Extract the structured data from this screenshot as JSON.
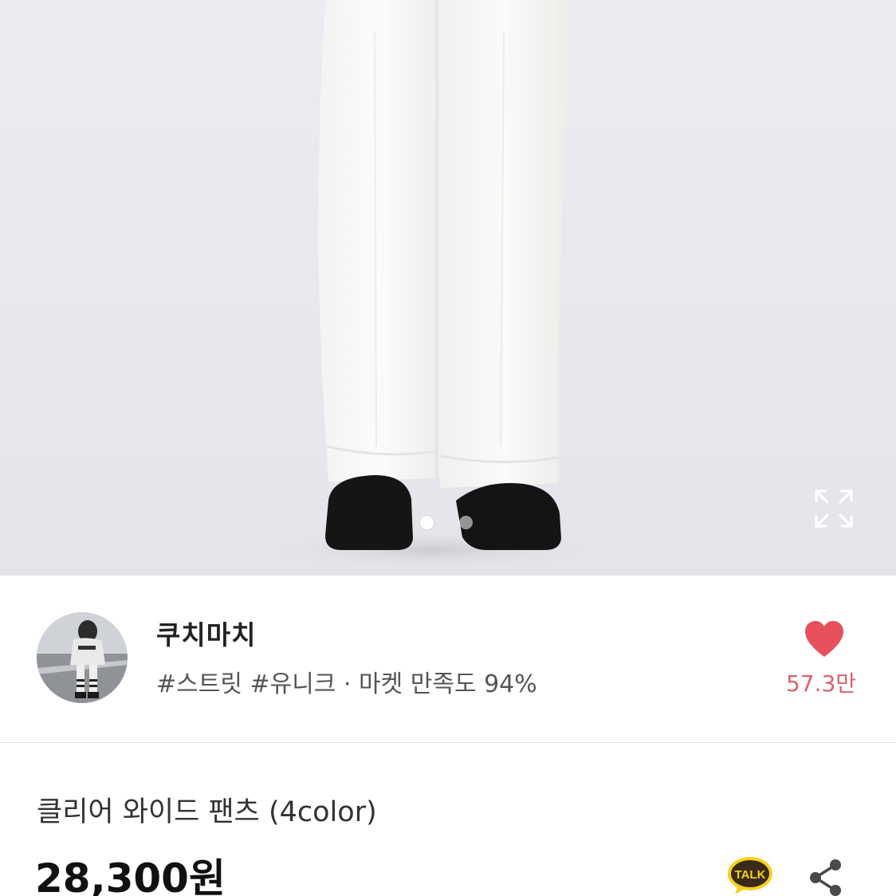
{
  "hero": {
    "carousel_total": 2,
    "carousel_active": 1
  },
  "seller": {
    "name": "쿠치마치",
    "tags_line": "#스트릿 #유니크 · 마켓 만족도 94%",
    "likes": "57.3만"
  },
  "product": {
    "title": "클리어 와이드 팬츠 (4color)",
    "price": "28,300원",
    "talk_label": "TALK"
  },
  "colors": {
    "heart": "#e8505b",
    "likes_text": "#d9636d",
    "talk_badge": "#3a2a1a"
  },
  "icons": {
    "expand": "expand-icon",
    "heart": "heart-icon",
    "talk": "kakao-talk-icon",
    "share": "share-icon"
  }
}
